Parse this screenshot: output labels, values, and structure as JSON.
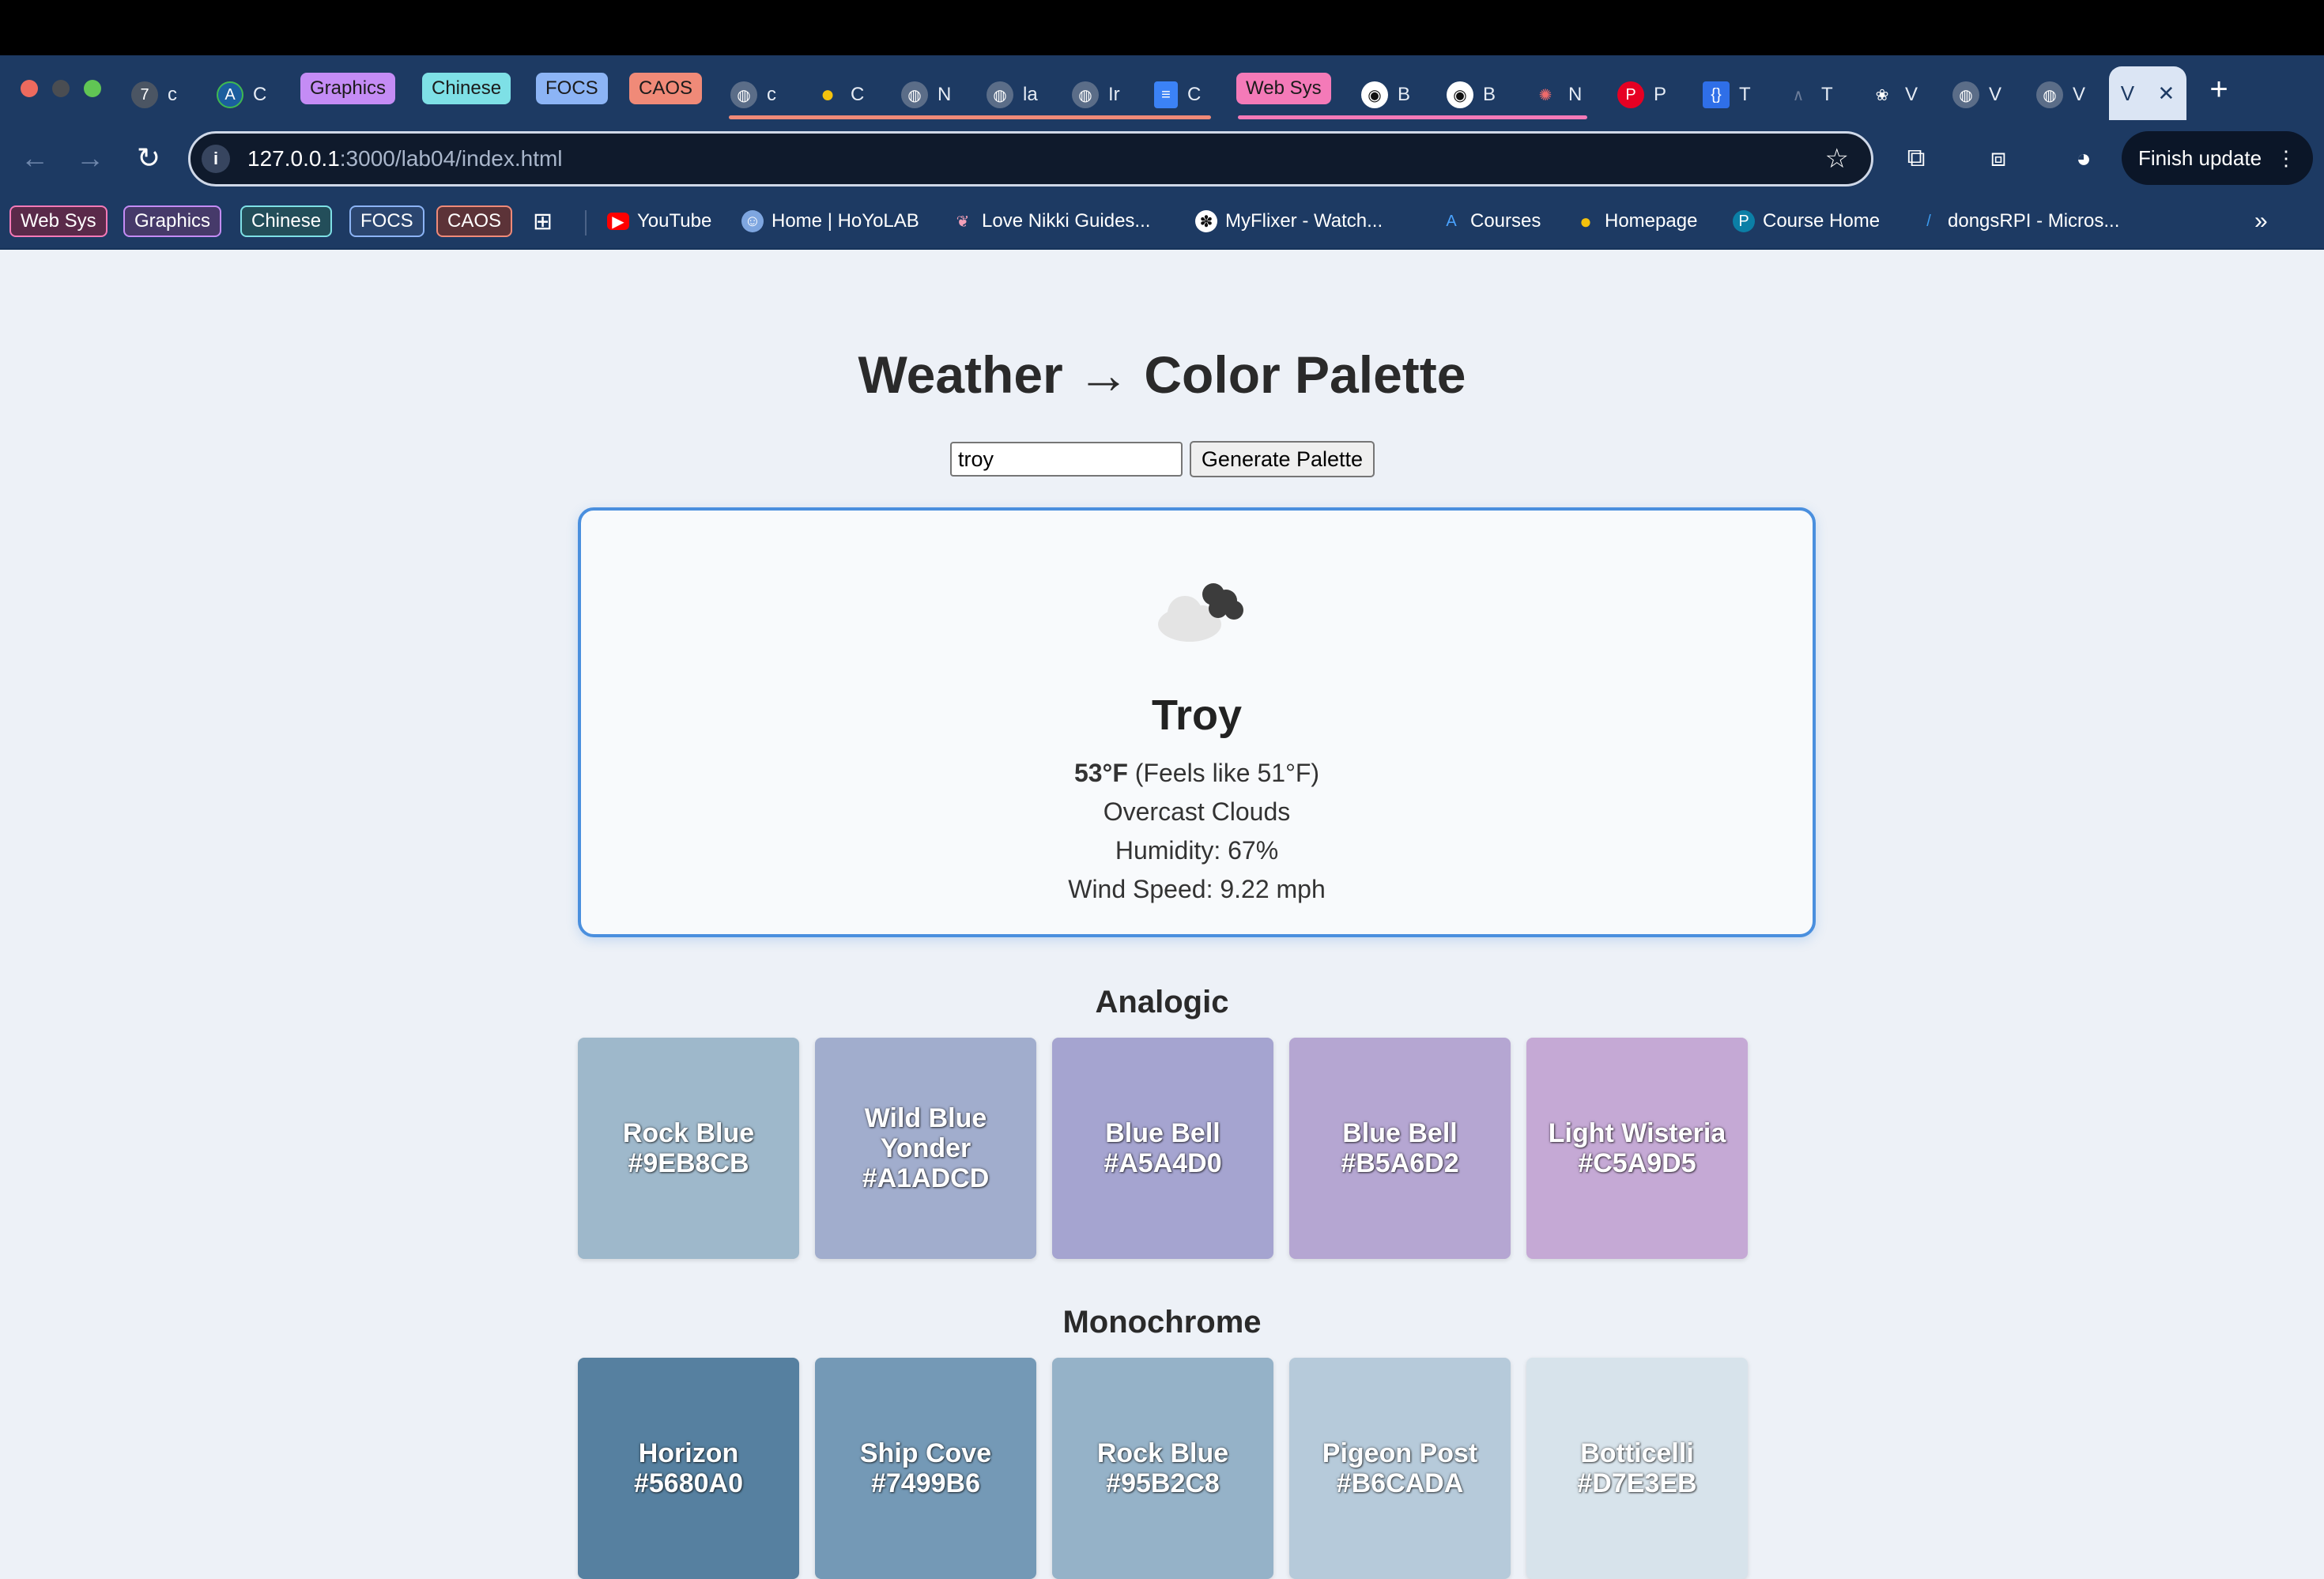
{
  "browser": {
    "tabs": [
      {
        "label": "c",
        "icon": "clock-app-icon"
      },
      {
        "label": "C",
        "icon": "a-logo-icon"
      },
      {
        "label": "c",
        "icon": "globe-icon"
      },
      {
        "label": "C",
        "icon": "duck-icon"
      },
      {
        "label": "N",
        "icon": "globe-icon"
      },
      {
        "label": "la",
        "icon": "globe-icon"
      },
      {
        "label": "Ir",
        "icon": "globe-icon"
      },
      {
        "label": "C",
        "icon": "docs-icon"
      },
      {
        "label": "B",
        "icon": "github-icon"
      },
      {
        "label": "B",
        "icon": "github-icon"
      },
      {
        "label": "N",
        "icon": "atom-icon"
      },
      {
        "label": "P",
        "icon": "pinterest-icon"
      },
      {
        "label": "T",
        "icon": "brackets-icon"
      },
      {
        "label": "T",
        "icon": "fin-icon"
      },
      {
        "label": "V",
        "icon": "openai-icon"
      },
      {
        "label": "V",
        "icon": "globe-icon"
      },
      {
        "label": "V",
        "icon": "globe-icon"
      }
    ],
    "tab_groups": [
      "Graphics",
      "Chinese",
      "FOCS",
      "CAOS",
      "Web Sys"
    ],
    "active_tab": {
      "label": "V",
      "close": "✕"
    },
    "new_tab": "+",
    "url_host": "127.0.0.1",
    "url_path": ":3000/lab04/index.html",
    "finish_update": "Finish update",
    "bookmark_groups": [
      "Web Sys",
      "Graphics",
      "Chinese",
      "FOCS",
      "CAOS"
    ],
    "bookmarks": [
      {
        "label": "YouTube",
        "icon": "youtube-icon"
      },
      {
        "label": "Home | HoYoLAB",
        "icon": "hoyolab-icon"
      },
      {
        "label": "Love Nikki Guides...",
        "icon": "nikki-icon"
      },
      {
        "label": "MyFlixer - Watch...",
        "icon": "myflixer-icon"
      },
      {
        "label": "Courses",
        "icon": "courses-icon"
      },
      {
        "label": "Homepage",
        "icon": "duck-icon"
      },
      {
        "label": "Course Home",
        "icon": "pearson-icon"
      },
      {
        "label": "dongsRPI - Micros...",
        "icon": "azure-icon"
      }
    ],
    "more_bookmarks": "»"
  },
  "page": {
    "title": "Weather → Color Palette",
    "input_value": "troy",
    "button_label": "Generate Palette"
  },
  "weather": {
    "icon": "overcast-clouds-icon",
    "city": "Troy",
    "temp": "53°F",
    "feels": "(Feels like 51°F)",
    "description": "Overcast Clouds",
    "humidity": "Humidity: 67%",
    "wind": "Wind Speed: 9.22 mph"
  },
  "palettes": [
    {
      "title": "Analogic",
      "swatches": [
        {
          "name": "Rock Blue",
          "hex": "#9EB8CB"
        },
        {
          "name": "Wild Blue Yonder",
          "hex": "#A1ADCD"
        },
        {
          "name": "Blue Bell",
          "hex": "#A5A4D0"
        },
        {
          "name": "Blue Bell",
          "hex": "#B5A6D2"
        },
        {
          "name": "Light Wisteria",
          "hex": "#C5A9D5"
        }
      ]
    },
    {
      "title": "Monochrome",
      "swatches": [
        {
          "name": "Horizon",
          "hex": "#5680A0"
        },
        {
          "name": "Ship Cove",
          "hex": "#7499B6"
        },
        {
          "name": "Rock Blue",
          "hex": "#95B2C8"
        },
        {
          "name": "Pigeon Post",
          "hex": "#B6CADA"
        },
        {
          "name": "Botticelli",
          "hex": "#D7E3EB"
        }
      ]
    }
  ]
}
